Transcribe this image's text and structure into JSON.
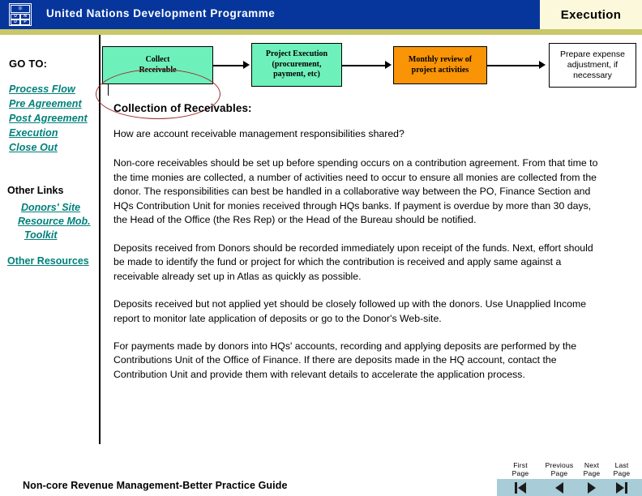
{
  "header": {
    "org_title": "United Nations Development Programme",
    "logo_emblem": "un-emblem-icon",
    "logo_letters": [
      "U",
      "N",
      "D",
      "P"
    ],
    "page_title": "Execution",
    "bar_color": "#06369c",
    "panel_color": "#fbf8dc",
    "band_color": "#c8c86a"
  },
  "sidebar": {
    "goto_label": "GO TO:",
    "links": [
      {
        "label": "Process Flow"
      },
      {
        "label": "Pre Agreement"
      },
      {
        "label": "Post Agreement"
      },
      {
        "label": "Execution"
      },
      {
        "label": "Close Out"
      }
    ],
    "other_links_label": "Other Links",
    "sub_links": [
      {
        "label": "Donors' Site"
      },
      {
        "label": "Resource Mob."
      },
      {
        "label": "Toolkit"
      }
    ],
    "other_resources_label": "Other Resources",
    "link_color": "#00807a"
  },
  "flow": {
    "highlight_color": "#9e2a2a",
    "boxes": [
      {
        "label_line1": "Collect",
        "label_line2": "Receivable",
        "label_line3": "",
        "fill": "#6ef0bb",
        "highlighted": true
      },
      {
        "label_line1": "Project Execution",
        "label_line2": "(procurement,",
        "label_line3": "payment, etc)",
        "fill": "#6ef0bb",
        "highlighted": false
      },
      {
        "label_line1": "Monthly review  of",
        "label_line2": "project activities",
        "label_line3": "",
        "fill": "#f89406",
        "highlighted": false
      },
      {
        "label_line1": "Prepare expense",
        "label_line2": "adjustment, if",
        "label_line3": "necessary",
        "fill": "#ffffff",
        "highlighted": false
      }
    ]
  },
  "content": {
    "heading": "Collection of Receivables:",
    "question": "How are account receivable management responsibilities shared?",
    "paragraphs": [
      "Non-core receivables should be set up before spending occurs on a contribution agreement. From that time to the time monies are collected, a number of activities need to occur to ensure all monies are collected from the donor.  The responsibilities can best be handled in a collaborative way between the PO, Finance Section and HQs Contribution Unit for monies received through HQs banks.  If payment is overdue by more than 30 days, the Head of the Office (the Res Rep) or the Head of the Bureau should be notified.",
      "Deposits received from Donors should be recorded immediately upon receipt of the funds.  Next, effort should be made to identify the fund or project for which the contribution is received and apply same against a receivable already set up in Atlas as quickly as possible.",
      "Deposits received but not applied yet should be closely followed up with the donors.   Use Unapplied Income report to monitor late application of deposits or go to the Donor's Web-site.",
      "For payments made by donors into HQs' accounts, recording and applying deposits are performed by the Contributions Unit of the Office of Finance. If there are deposits made in the HQ account, contact the Contribution Unit and provide them with relevant details to accelerate the application process."
    ]
  },
  "footer": {
    "document_title": "Non-core Revenue Management-Better Practice Guide",
    "nav_bar_color": "#a8ccd8",
    "nav_buttons": [
      {
        "line1": "First",
        "line2": "Page",
        "icon": "first-page-icon"
      },
      {
        "line1": "Previous",
        "line2": "Page",
        "icon": "previous-page-icon"
      },
      {
        "line1": "Next",
        "line2": "Page",
        "icon": "next-page-icon"
      },
      {
        "line1": "Last",
        "line2": "Page",
        "icon": "last-page-icon"
      }
    ]
  }
}
